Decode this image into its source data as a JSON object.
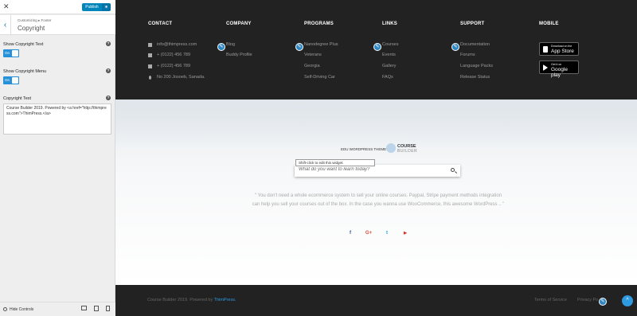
{
  "customizer": {
    "close_icon": "close-icon",
    "publish_label": "Publish",
    "breadcrumb": "Customizing ▸ Footer",
    "section_title": "Copyright",
    "controls": {
      "show_copyright_text": {
        "label": "Show Copyright Text",
        "toggle": "On"
      },
      "show_copyright_menu": {
        "label": "Show Copyright Menu",
        "toggle": "On"
      },
      "copyright_text": {
        "label": "Copyright Text",
        "value": "Course Builder 2019. Powered by <a href=\"http://thimpress.com\">ThimPress.</a>"
      }
    },
    "hide_controls": "Hide Controls"
  },
  "footer": {
    "contact": {
      "heading": "CONTACT",
      "items": [
        "info@thimpress.com",
        "+ (0122) 456 789",
        "+ (0122) 456 789",
        "No 200 Josoeb, Sanada."
      ]
    },
    "company": {
      "heading": "COMPANY",
      "items": [
        "Blog",
        "Buddy Profile"
      ]
    },
    "programs": {
      "heading": "PROGRAMS",
      "items": [
        "Nanodegree Plus",
        "Veterans",
        "Georgia",
        "Self-Driving Car"
      ]
    },
    "links": {
      "heading": "LINKS",
      "items": [
        "Courses",
        "Events",
        "Gallery",
        "FAQs"
      ]
    },
    "support": {
      "heading": "SUPPORT",
      "items": [
        "Documentation",
        "Forums",
        "Language Packs",
        "Release Status"
      ]
    },
    "mobile": {
      "heading": "MOBILE",
      "app_store": {
        "small": "Download on the",
        "big": "App Store"
      },
      "google_play": {
        "small": "Get it on",
        "big": "Google play"
      }
    }
  },
  "hero": {
    "tagline": "EDU WORDPRESS THEME",
    "logo_line1": "COURSE",
    "logo_line2": "BUILDER",
    "tooltip": "Shift-click to edit this widget.",
    "search_placeholder": "What do you want to learn today?",
    "description": "\" You don't need a whole ecommerce system to sell your online courses. Paypal, Stripe payment methods integration can help you sell your courses out of the box. In the case you wanna use WooCommerce, this awesome WordPress .. \"",
    "social": {
      "facebook": "f",
      "googleplus": "G+",
      "twitter": "t",
      "youtube": "▶"
    }
  },
  "bottom_bar": {
    "credit_prefix": "Course Builder 2019. Powered by ",
    "credit_link": "ThimPress.",
    "terms": "Terms of Service",
    "privacy": "Privacy Po",
    "back_to_top": "^"
  },
  "colors": {
    "accent": "#2e9ae0",
    "dark_bg": "#222222",
    "wp_blue": "#0085ba"
  }
}
